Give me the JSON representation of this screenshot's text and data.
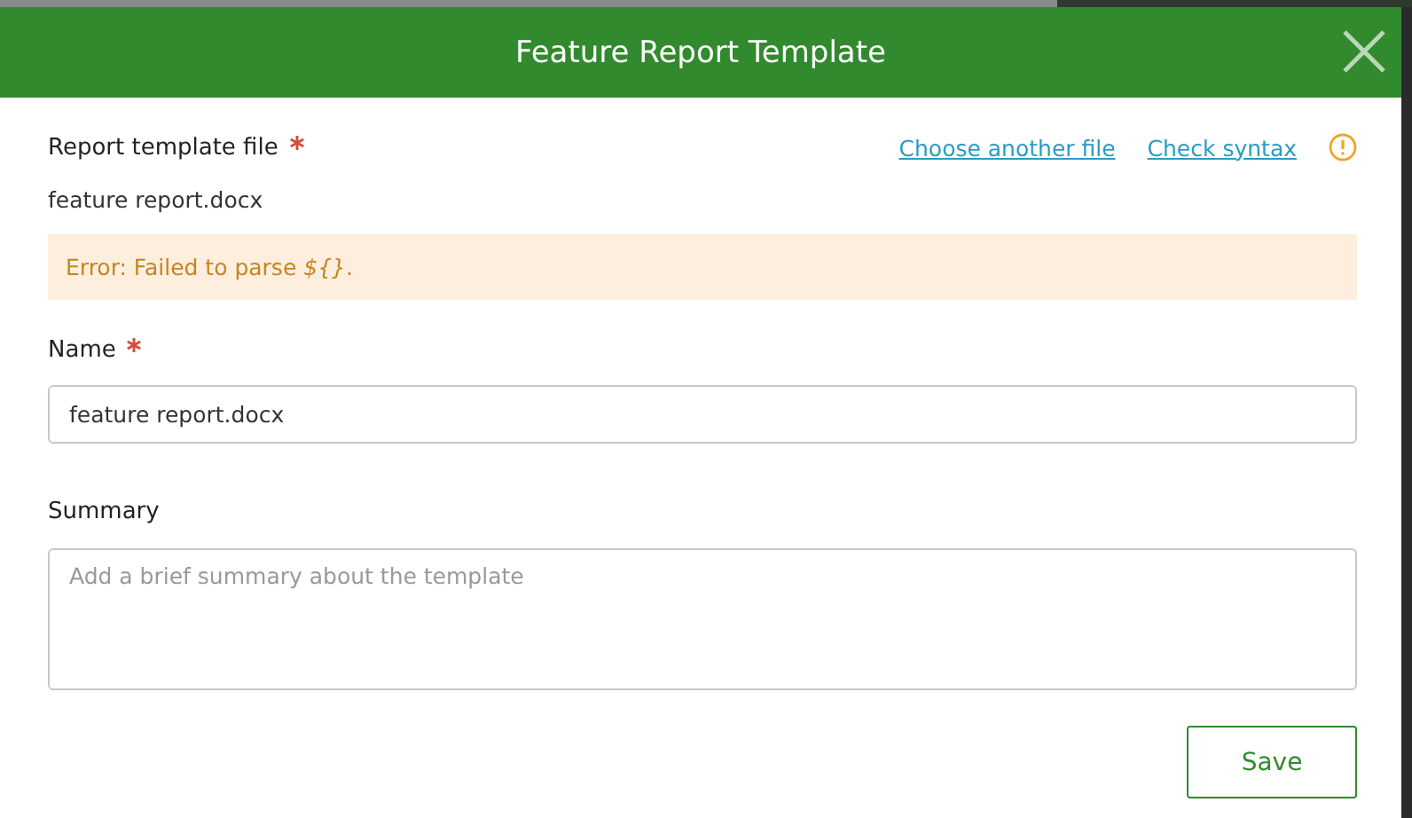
{
  "dialog": {
    "title": "Feature Report Template"
  },
  "template_file": {
    "label": "Report template file",
    "required": true,
    "file_name": "feature report.docx",
    "links": [
      "Choose another file",
      "Check syntax"
    ],
    "warning": true,
    "error": "Error: Failed to parse *${}*."
  },
  "name": {
    "label": "Name",
    "required": true,
    "value": "feature report.docx"
  },
  "summary": {
    "label": "Summary",
    "required": false,
    "placeholder": "Add a brief summary about the template"
  },
  "buttons": [
    "Save"
  ]
}
